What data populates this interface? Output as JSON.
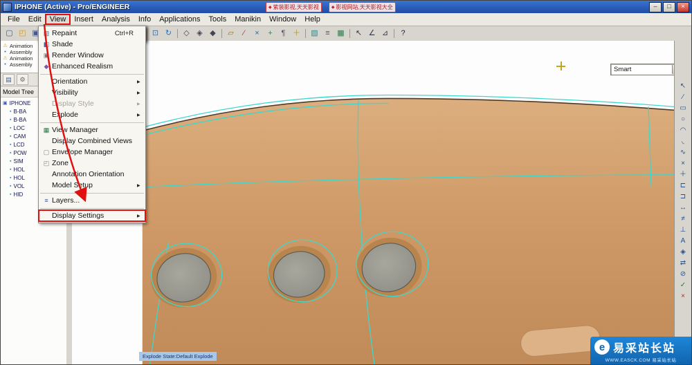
{
  "colors": {
    "titlebar_blue": "#2a5cb8",
    "accent_red": "#e01010",
    "model_tan": "#cf9a67",
    "edge_cyan": "#3fd6cc",
    "status_blue": "#a9c7e8",
    "watermark_blue": "#1164ae"
  },
  "window": {
    "title": "IPHONE (Active) - Pro/ENGINEER",
    "controls": [
      {
        "name": "minimize-button",
        "glyph": "–"
      },
      {
        "name": "maximize-button",
        "glyph": "□"
      },
      {
        "name": "close-button",
        "glyph": "×"
      }
    ],
    "overlay_tabs": [
      {
        "name": "overlay-tab-1",
        "glyph": "◆",
        "color": "#c02020",
        "label": "紫装影视,天天影视"
      },
      {
        "name": "overlay-tab-2",
        "glyph": "◆",
        "color": "#c02020",
        "label": "影视网站,天天影视大全"
      }
    ]
  },
  "menu_bar": {
    "items": [
      {
        "name": "menu-file",
        "label": "File"
      },
      {
        "name": "menu-edit",
        "label": "Edit"
      },
      {
        "name": "menu-view",
        "label": "View",
        "highlighted": true
      },
      {
        "name": "menu-insert",
        "label": "Insert"
      },
      {
        "name": "menu-analysis",
        "label": "Analysis"
      },
      {
        "name": "menu-info",
        "label": "Info"
      },
      {
        "name": "menu-applications",
        "label": "Applications"
      },
      {
        "name": "menu-tools",
        "label": "Tools"
      },
      {
        "name": "menu-manikin",
        "label": "Manikin"
      },
      {
        "name": "menu-window",
        "label": "Window"
      },
      {
        "name": "menu-help",
        "label": "Help"
      }
    ]
  },
  "toolbar": {
    "icons": [
      {
        "name": "new-file-icon",
        "glyph": "▢",
        "color": "#3b5aa0"
      },
      {
        "name": "open-file-icon",
        "glyph": "◰",
        "color": "#c79a2e"
      },
      {
        "name": "save-icon",
        "glyph": "▣",
        "color": "#3b5aa0"
      },
      {
        "name": "print-icon",
        "glyph": "▤",
        "color": "#556"
      },
      {
        "sep": true
      },
      {
        "name": "undo-icon",
        "glyph": "↶",
        "color": "#2e6fc0"
      },
      {
        "name": "redo-icon",
        "glyph": "↷",
        "color": "#999"
      },
      {
        "sep": true
      },
      {
        "name": "regenerate-icon",
        "glyph": "↯",
        "color": "#c03030"
      },
      {
        "name": "find-icon",
        "glyph": "◉",
        "color": "#2e7d6e"
      },
      {
        "sep": true
      },
      {
        "name": "zoom-in-icon",
        "glyph": "⊕",
        "color": "#2e6fc0"
      },
      {
        "name": "zoom-out-icon",
        "glyph": "⊖",
        "color": "#2e6fc0"
      },
      {
        "name": "refit-icon",
        "glyph": "⊡",
        "color": "#2e6fc0"
      },
      {
        "name": "reorient-icon",
        "glyph": "↻",
        "color": "#2e6fc0"
      },
      {
        "name": "saved-views-icon",
        "glyph": "▥",
        "color": "#556",
        "dropdown": true
      },
      {
        "sep": true
      },
      {
        "name": "wireframe-icon",
        "glyph": "◇",
        "color": "#445"
      },
      {
        "name": "hidden-line-icon",
        "glyph": "◈",
        "color": "#445"
      },
      {
        "name": "no-hidden-line-icon",
        "glyph": "◆",
        "color": "#445"
      },
      {
        "name": "shaded-icon",
        "glyph": "●",
        "color": "#8a7350",
        "dropdown": true
      },
      {
        "sep": true
      },
      {
        "name": "datum-planes-icon",
        "glyph": "▱",
        "color": "#96731f"
      },
      {
        "name": "datum-axes-icon",
        "glyph": "∕",
        "color": "#a03535"
      },
      {
        "name": "datum-points-icon",
        "glyph": "×",
        "color": "#2f6a8a"
      },
      {
        "name": "datum-csys-icon",
        "glyph": "+",
        "color": "#2f8a4a"
      },
      {
        "name": "annotation-display-icon",
        "glyph": "¶",
        "color": "#556"
      },
      {
        "name": "spin-center-toggle-icon",
        "glyph": "＋",
        "color": "#b09a28"
      },
      {
        "sep": true
      },
      {
        "name": "repaint-icon",
        "glyph": "▧",
        "color": "#2e8b8b"
      },
      {
        "name": "layers-icon",
        "glyph": "≡",
        "color": "#556"
      },
      {
        "name": "model-tree-toggle-icon",
        "glyph": "▦",
        "color": "#2a7a4a"
      },
      {
        "sep": true
      },
      {
        "name": "select-arrow-icon",
        "glyph": "↖",
        "color": "#334"
      },
      {
        "name": "angle-measure-icon",
        "glyph": "∠",
        "color": "#334"
      },
      {
        "name": "section-icon",
        "glyph": "⊿",
        "color": "#334"
      },
      {
        "sep": true
      },
      {
        "name": "help-icon",
        "glyph": "?",
        "color": "#223"
      }
    ]
  },
  "view_menu": {
    "items": [
      {
        "name": "menu-repaint",
        "label": "Repaint",
        "shortcut": "Ctrl+R",
        "glyph": "▧",
        "color": "#2e8b8b"
      },
      {
        "name": "menu-shade",
        "label": "Shade",
        "glyph": "◧",
        "color": "#4169aa"
      },
      {
        "name": "menu-render-window",
        "label": "Render Window",
        "glyph": "▣",
        "color": "#777"
      },
      {
        "name": "menu-enhanced-realism",
        "label": "Enhanced Realism",
        "glyph": "◆",
        "color": "#7a5aa0",
        "separator_after": true
      },
      {
        "name": "menu-orientation",
        "label": "Orientation",
        "submenu": true
      },
      {
        "name": "menu-visibility",
        "label": "Visibility",
        "submenu": true
      },
      {
        "name": "menu-display-style",
        "label": "Display Style",
        "submenu": true,
        "disabled": true
      },
      {
        "name": "menu-explode",
        "label": "Explode",
        "submenu": true,
        "separator_after": true
      },
      {
        "name": "menu-view-manager",
        "label": "View Manager",
        "glyph": "▦",
        "color": "#2a7a4a"
      },
      {
        "name": "menu-display-combined-views",
        "label": "Display Combined Views"
      },
      {
        "name": "menu-envelope-manager",
        "label": "Envelope Manager",
        "glyph": "▢",
        "color": "#888"
      },
      {
        "name": "menu-zone",
        "label": "Zone",
        "glyph": "◰",
        "color": "#888"
      },
      {
        "name": "menu-annotation-orientation",
        "label": "Annotation Orientation"
      },
      {
        "name": "menu-model-setup",
        "label": "Model Setup",
        "submenu": true,
        "separator_after": true
      },
      {
        "name": "menu-layers",
        "label": "Layers...",
        "glyph": "≡",
        "color": "#3b5aa0",
        "separator_after": true
      },
      {
        "name": "menu-display-settings",
        "label": "Display Settings",
        "submenu": true,
        "highlighted": true
      }
    ]
  },
  "left_panel": {
    "annotations": [
      {
        "name": "annotation-animation-1",
        "glyph": "⚠",
        "color": "#d89c00",
        "label": "Animation"
      },
      {
        "name": "annotation-assembly-1",
        "glyph": "•",
        "color": "#3b5aa0",
        "label": "Assembly"
      },
      {
        "name": "annotation-animation-2",
        "glyph": "⚠",
        "color": "#d89c00",
        "label": "Animation"
      },
      {
        "name": "annotation-assembly-2",
        "glyph": "•",
        "color": "#3b5aa0",
        "label": "Assembly"
      }
    ],
    "mini_icons": [
      {
        "name": "navigator-list-icon",
        "glyph": "▤",
        "color": "#3b5aa0"
      },
      {
        "name": "navigator-settings-icon",
        "glyph": "⚙",
        "color": "#666"
      }
    ],
    "tree_header": "Model Tree",
    "tree_header_icons": [
      {
        "name": "tree-settings-icon",
        "glyph": "⚙"
      },
      {
        "name": "tree-show-icon",
        "glyph": "▾"
      }
    ],
    "tree": [
      {
        "name": "tree-item-iphone",
        "label": "IPHONE",
        "glyph": "▣",
        "color": "#3b5aa0",
        "root": true
      },
      {
        "name": "tree-item-b-ba-1",
        "label": "B-BA",
        "glyph": "▪",
        "color": "#2e86b0"
      },
      {
        "name": "tree-item-b-ba-2",
        "label": "B-BA",
        "glyph": "▪",
        "color": "#2e86b0"
      },
      {
        "name": "tree-item-loc",
        "label": "LOC",
        "glyph": "▪",
        "color": "#2e86b0"
      },
      {
        "name": "tree-item-cam",
        "label": "CAM",
        "glyph": "▪",
        "color": "#2e86b0"
      },
      {
        "name": "tree-item-lcd",
        "label": "LCD",
        "glyph": "▪",
        "color": "#2e86b0"
      },
      {
        "name": "tree-item-pow",
        "label": "POW",
        "glyph": "▪",
        "color": "#2e86b0"
      },
      {
        "name": "tree-item-sim",
        "label": "SIM",
        "glyph": "▪",
        "color": "#2e86b0"
      },
      {
        "name": "tree-item-hol-1",
        "label": "HOL",
        "glyph": "▪",
        "color": "#2e86b0"
      },
      {
        "name": "tree-item-hol-2",
        "label": "HOL",
        "glyph": "▪",
        "color": "#2e86b0"
      },
      {
        "name": "tree-item-vol",
        "label": "VOL",
        "glyph": "▪",
        "color": "#2e86b0"
      },
      {
        "name": "tree-item-hid",
        "label": "HID",
        "glyph": "▪",
        "color": "#2e86b0"
      }
    ]
  },
  "right_toolbar": {
    "icons": [
      {
        "name": "select-tool-icon",
        "glyph": "↖",
        "color": "#24508c"
      },
      {
        "name": "line-tool-icon",
        "glyph": "∕",
        "color": "#24508c"
      },
      {
        "name": "rectangle-tool-icon",
        "glyph": "▭",
        "color": "#24508c"
      },
      {
        "name": "circle-tool-icon",
        "glyph": "○",
        "color": "#24508c"
      },
      {
        "name": "arc-tool-icon",
        "glyph": "◠",
        "color": "#24508c"
      },
      {
        "name": "fillet-tool-icon",
        "glyph": "◟",
        "color": "#24508c"
      },
      {
        "name": "spline-tool-icon",
        "glyph": "∿",
        "color": "#24508c"
      },
      {
        "name": "point-tool-icon",
        "glyph": "×",
        "color": "#24508c"
      },
      {
        "name": "csys-tool-icon",
        "glyph": "＋",
        "color": "#24508c"
      },
      {
        "name": "use-edge-tool-icon",
        "glyph": "⊏",
        "color": "#24508c"
      },
      {
        "name": "offset-edge-tool-icon",
        "glyph": "⊐",
        "color": "#24508c"
      },
      {
        "name": "dimension-tool-icon",
        "glyph": "↔",
        "color": "#24508c"
      },
      {
        "name": "modify-tool-icon",
        "glyph": "≠",
        "color": "#24508c"
      },
      {
        "name": "constraint-tool-icon",
        "glyph": "⊥",
        "color": "#24508c"
      },
      {
        "name": "text-tool-icon",
        "glyph": "A",
        "color": "#24508c"
      },
      {
        "name": "palette-tool-icon",
        "glyph": "◈",
        "color": "#24508c"
      },
      {
        "name": "mirror-tool-icon",
        "glyph": "⇄",
        "color": "#24508c"
      },
      {
        "name": "trim-tool-icon",
        "glyph": "⊘",
        "color": "#24508c"
      },
      {
        "name": "done-icon",
        "glyph": "✓",
        "color": "#2a7a2a"
      },
      {
        "name": "cancel-icon",
        "glyph": "×",
        "color": "#a03030"
      }
    ]
  },
  "viewport": {
    "status_text": "Explode State:Default Explode",
    "filter_label": "Smart"
  },
  "watermark": {
    "logo_letter": "e",
    "brand": "易采站长站",
    "subtext": "WWW.EASCK.COM  易采站长站"
  }
}
